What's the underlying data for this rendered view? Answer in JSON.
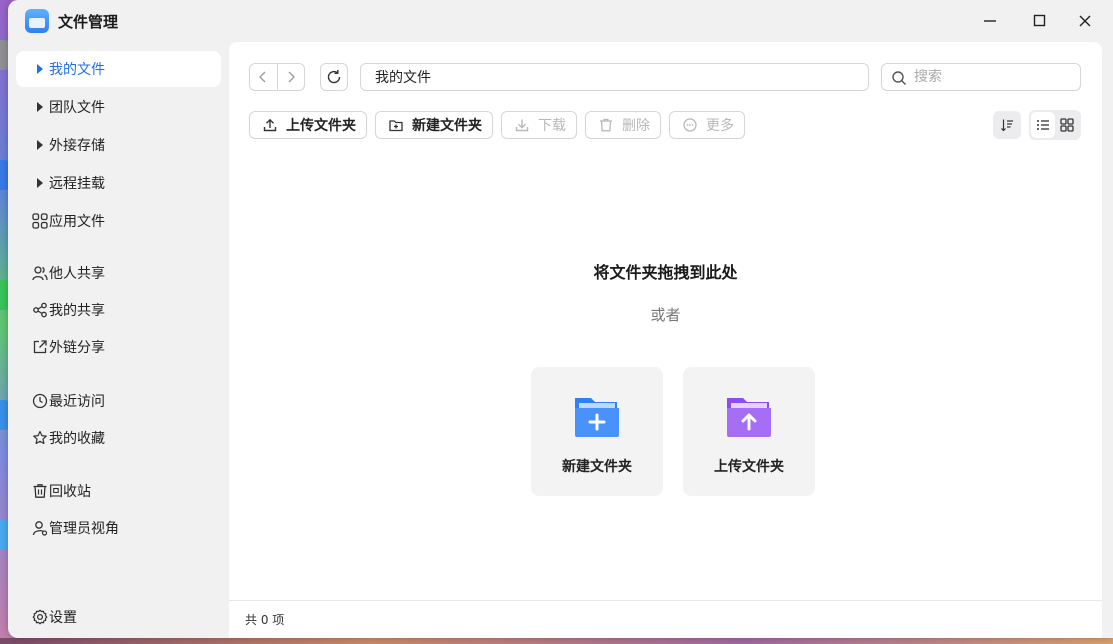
{
  "window": {
    "title": "文件管理",
    "controls": [
      "minimize",
      "maximize",
      "close"
    ]
  },
  "sidebar": {
    "items": [
      {
        "label": "我的文件",
        "icon": "expand-triangle-icon",
        "active": true
      },
      {
        "label": "团队文件",
        "icon": "expand-triangle-icon"
      },
      {
        "label": "外接存储",
        "icon": "expand-triangle-icon"
      },
      {
        "label": "远程挂载",
        "icon": "expand-triangle-icon"
      },
      {
        "label": "应用文件",
        "icon": "apps-grid-icon"
      },
      {
        "label": "他人共享",
        "icon": "people-icon"
      },
      {
        "label": "我的共享",
        "icon": "share-icon"
      },
      {
        "label": "外链分享",
        "icon": "external-link-icon"
      },
      {
        "label": "最近访问",
        "icon": "clock-icon"
      },
      {
        "label": "我的收藏",
        "icon": "star-icon"
      },
      {
        "label": "回收站",
        "icon": "trash-icon"
      },
      {
        "label": "管理员视角",
        "icon": "admin-user-icon"
      }
    ],
    "settings_label": "设置"
  },
  "toolbar": {
    "path_value": "我的文件",
    "search_placeholder": "搜索",
    "buttons": [
      {
        "label": "上传文件夹",
        "icon": "upload-icon",
        "enabled": true
      },
      {
        "label": "新建文件夹",
        "icon": "new-folder-icon",
        "enabled": true
      },
      {
        "label": "下载",
        "icon": "download-icon",
        "enabled": false
      },
      {
        "label": "删除",
        "icon": "trash-icon",
        "enabled": false
      },
      {
        "label": "更多",
        "icon": "more-icon",
        "enabled": false
      }
    ],
    "view_mode": "grid"
  },
  "empty_state": {
    "title": "将文件夹拖拽到此处",
    "or_text": "或者",
    "cards": [
      {
        "label": "新建文件夹",
        "icon": "new-folder-plus-icon",
        "color": "#2f7ff5"
      },
      {
        "label": "上传文件夹",
        "icon": "upload-folder-icon",
        "color": "#9a5ef0"
      }
    ]
  },
  "status": {
    "count_text": "共 0 项"
  },
  "colors": {
    "accent": "#1f6feb",
    "sidebar_bg": "#f1f1f2",
    "main_bg": "#ffffff"
  }
}
